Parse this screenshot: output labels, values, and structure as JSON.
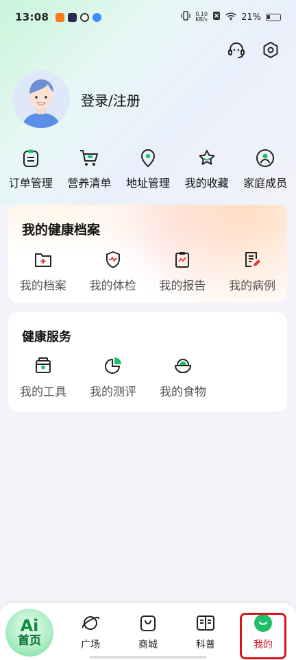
{
  "status_bar": {
    "time": "13:08",
    "net_speed_value": "0.10",
    "net_speed_unit": "KB/s",
    "battery": "21%"
  },
  "profile": {
    "login_label": "登录/注册"
  },
  "quick_actions": [
    {
      "label": "订单管理",
      "icon": "order-icon"
    },
    {
      "label": "营养清单",
      "icon": "cart-icon"
    },
    {
      "label": "地址管理",
      "icon": "location-icon"
    },
    {
      "label": "我的收藏",
      "icon": "star-icon"
    },
    {
      "label": "家庭成员",
      "icon": "family-icon"
    }
  ],
  "health_archive": {
    "title": "我的健康档案",
    "items": [
      {
        "label": "我的档案",
        "icon": "folder-plus-icon"
      },
      {
        "label": "我的体检",
        "icon": "shield-pulse-icon"
      },
      {
        "label": "我的报告",
        "icon": "clipboard-chart-icon"
      },
      {
        "label": "我的病例",
        "icon": "document-edit-icon"
      }
    ]
  },
  "health_service": {
    "title": "健康服务",
    "items": [
      {
        "label": "我的工具",
        "icon": "toolbox-icon"
      },
      {
        "label": "我的测评",
        "icon": "pie-chart-icon"
      },
      {
        "label": "我的食物",
        "icon": "food-bowl-icon"
      }
    ]
  },
  "bottom_nav": {
    "home": {
      "mark": "Ai",
      "label": "首页"
    },
    "items": [
      {
        "label": "广场",
        "icon": "planet-icon"
      },
      {
        "label": "商城",
        "icon": "shopping-bag-icon"
      },
      {
        "label": "科普",
        "icon": "book-icon"
      },
      {
        "label": "我的",
        "icon": "profile-smile-icon"
      }
    ]
  },
  "colors": {
    "accent": "#1fbf6a",
    "highlight_border": "#d8141c"
  }
}
